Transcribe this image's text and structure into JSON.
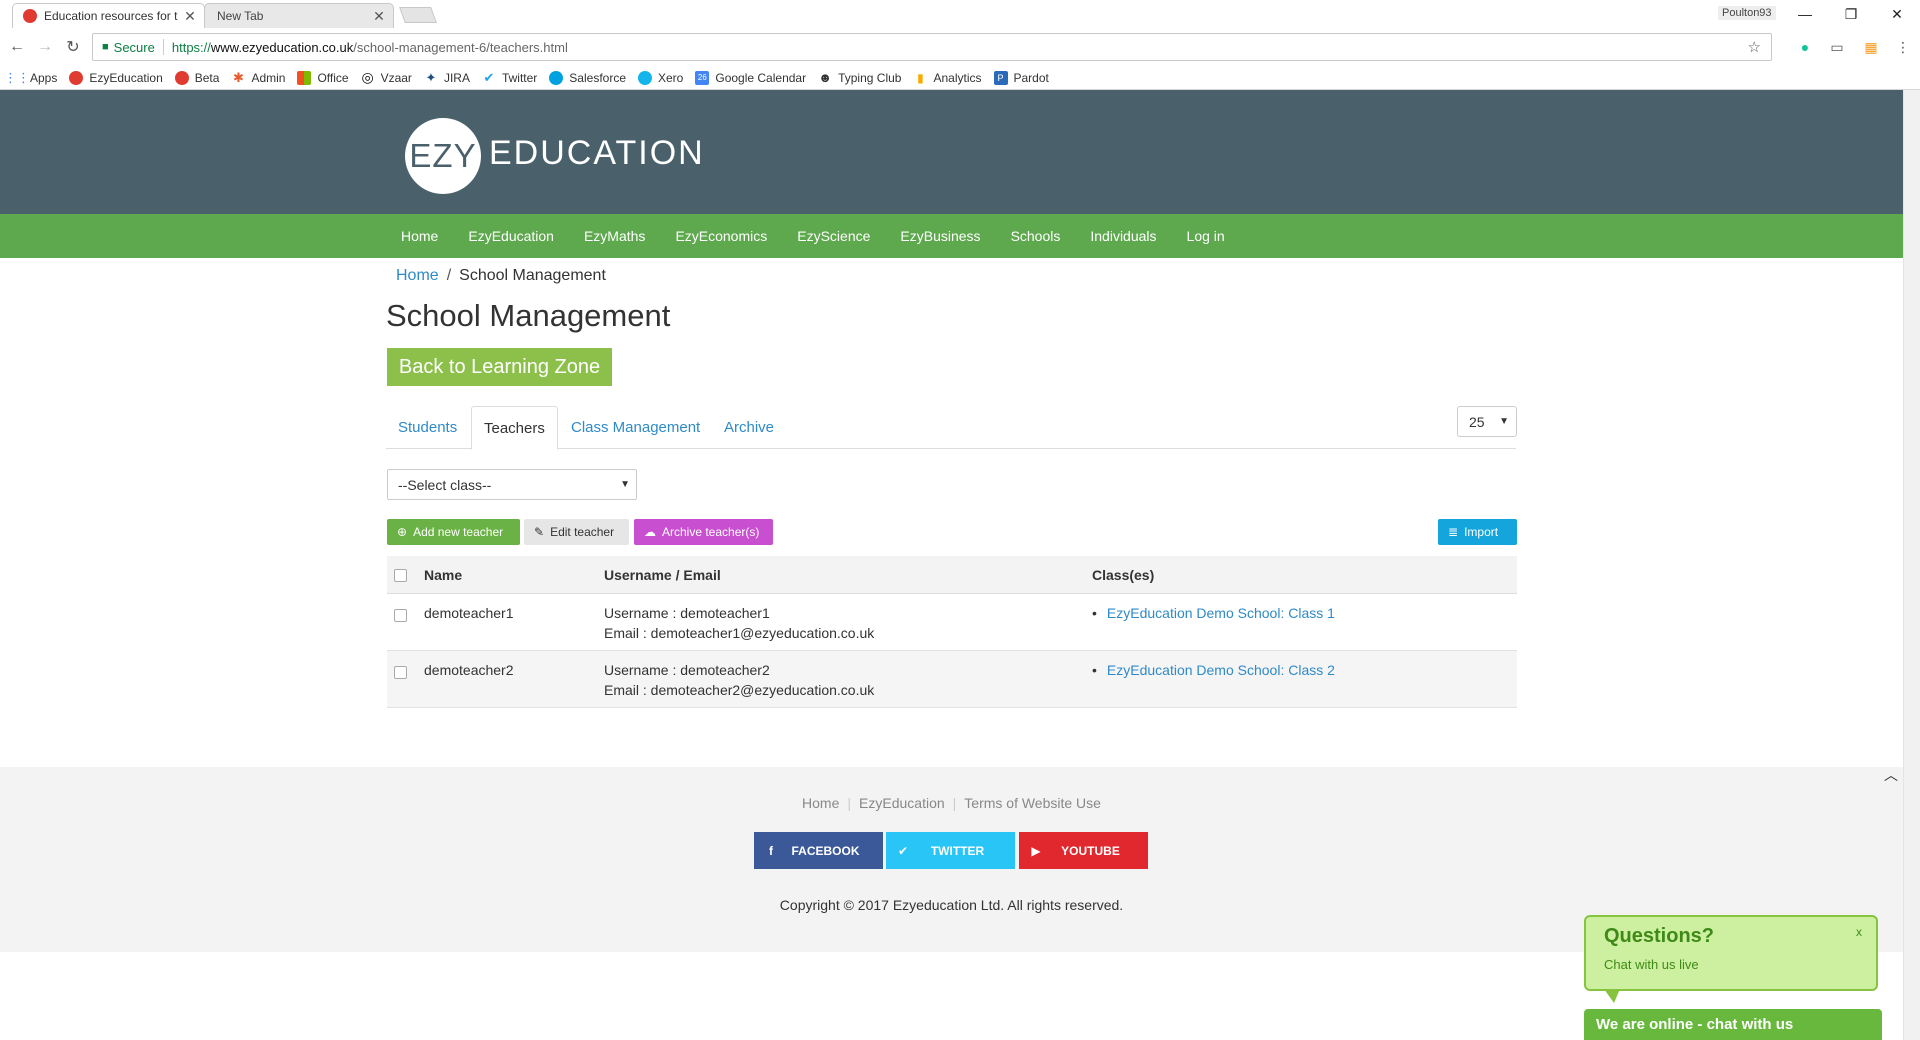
{
  "browser": {
    "tabs": [
      {
        "title": "Education resources for t",
        "active": true
      },
      {
        "title": "New Tab",
        "active": false
      }
    ],
    "profile_name": "Poulton93",
    "secure_label": "Secure",
    "url": {
      "protocol": "https://",
      "host": "www.ezyeducation.co.uk",
      "path": "/school-management-6/teachers.html"
    },
    "bookmarks": [
      {
        "label": "Apps",
        "icon": "apps-grid-icon",
        "color": "#4285f4"
      },
      {
        "label": "EzyEducation",
        "icon": "ezy-icon",
        "color": "#e03b30"
      },
      {
        "label": "Beta",
        "icon": "ezy-icon",
        "color": "#e03b30"
      },
      {
        "label": "Admin",
        "icon": "joomla-icon",
        "color": "#e65b2a"
      },
      {
        "label": "Office",
        "icon": "office-icon",
        "color": "#f25022"
      },
      {
        "label": "Vzaar",
        "icon": "vzaar-icon",
        "color": "#111111"
      },
      {
        "label": "JIRA",
        "icon": "jira-icon",
        "color": "#205081"
      },
      {
        "label": "Twitter",
        "icon": "twitter-icon",
        "color": "#1da1f2"
      },
      {
        "label": "Salesforce",
        "icon": "salesforce-icon",
        "color": "#00a1e0"
      },
      {
        "label": "Xero",
        "icon": "xero-icon",
        "color": "#13b5ea"
      },
      {
        "label": "Google Calendar",
        "icon": "calendar-icon",
        "color": "#4285f4"
      },
      {
        "label": "Typing Club",
        "icon": "typing-club-icon",
        "color": "#333333"
      },
      {
        "label": "Analytics",
        "icon": "analytics-icon",
        "color": "#f9ab00"
      },
      {
        "label": "Pardot",
        "icon": "pardot-icon",
        "color": "#2a6ab8"
      }
    ]
  },
  "site": {
    "logo": {
      "circle_text": "EZY",
      "text": "EDUCATION"
    },
    "nav": [
      "Home",
      "EzyEducation",
      "EzyMaths",
      "EzyEconomics",
      "EzyScience",
      "EzyBusiness",
      "Schools",
      "Individuals",
      "Log in"
    ],
    "breadcrumb": {
      "home": "Home",
      "current": "School Management"
    },
    "page_title": "School Management",
    "back_button": "Back to Learning Zone",
    "tabs": [
      "Students",
      "Teachers",
      "Class Management",
      "Archive"
    ],
    "active_tab": "Teachers",
    "per_page": "25",
    "class_select": "--Select class--",
    "actions": {
      "add": "Add new teacher",
      "edit": "Edit teacher",
      "archive": "Archive teacher(s)",
      "import": "Import"
    },
    "table": {
      "headers": {
        "name": "Name",
        "user": "Username / Email",
        "classes": "Class(es)"
      },
      "rows": [
        {
          "name": "demoteacher1",
          "username": "Username : demoteacher1",
          "email": "Email : demoteacher1@ezyeducation.co.uk",
          "class": "EzyEducation Demo School: Class 1"
        },
        {
          "name": "demoteacher2",
          "username": "Username : demoteacher2",
          "email": "Email : demoteacher2@ezyeducation.co.uk",
          "class": "EzyEducation Demo School: Class 2"
        }
      ]
    },
    "footer": {
      "links": [
        "Home",
        "EzyEducation",
        "Terms of Website Use"
      ],
      "social": {
        "facebook": "FACEBOOK",
        "twitter": "TWITTER",
        "youtube": "YOUTUBE"
      },
      "copyright": "Copyright © 2017 Ezyeducation Ltd. All rights reserved."
    },
    "chat": {
      "title": "Questions?",
      "subtitle": "Chat with us live",
      "close": "x",
      "bar": "We are online - chat with us"
    },
    "colors": {
      "header": "#4a616c",
      "nav": "#5ea84e",
      "back_button": "#8cc04b",
      "link": "#2f8ac7",
      "add_button": "#6ab245",
      "archive_button": "#c94fd1",
      "import_button": "#13a5dc"
    }
  }
}
